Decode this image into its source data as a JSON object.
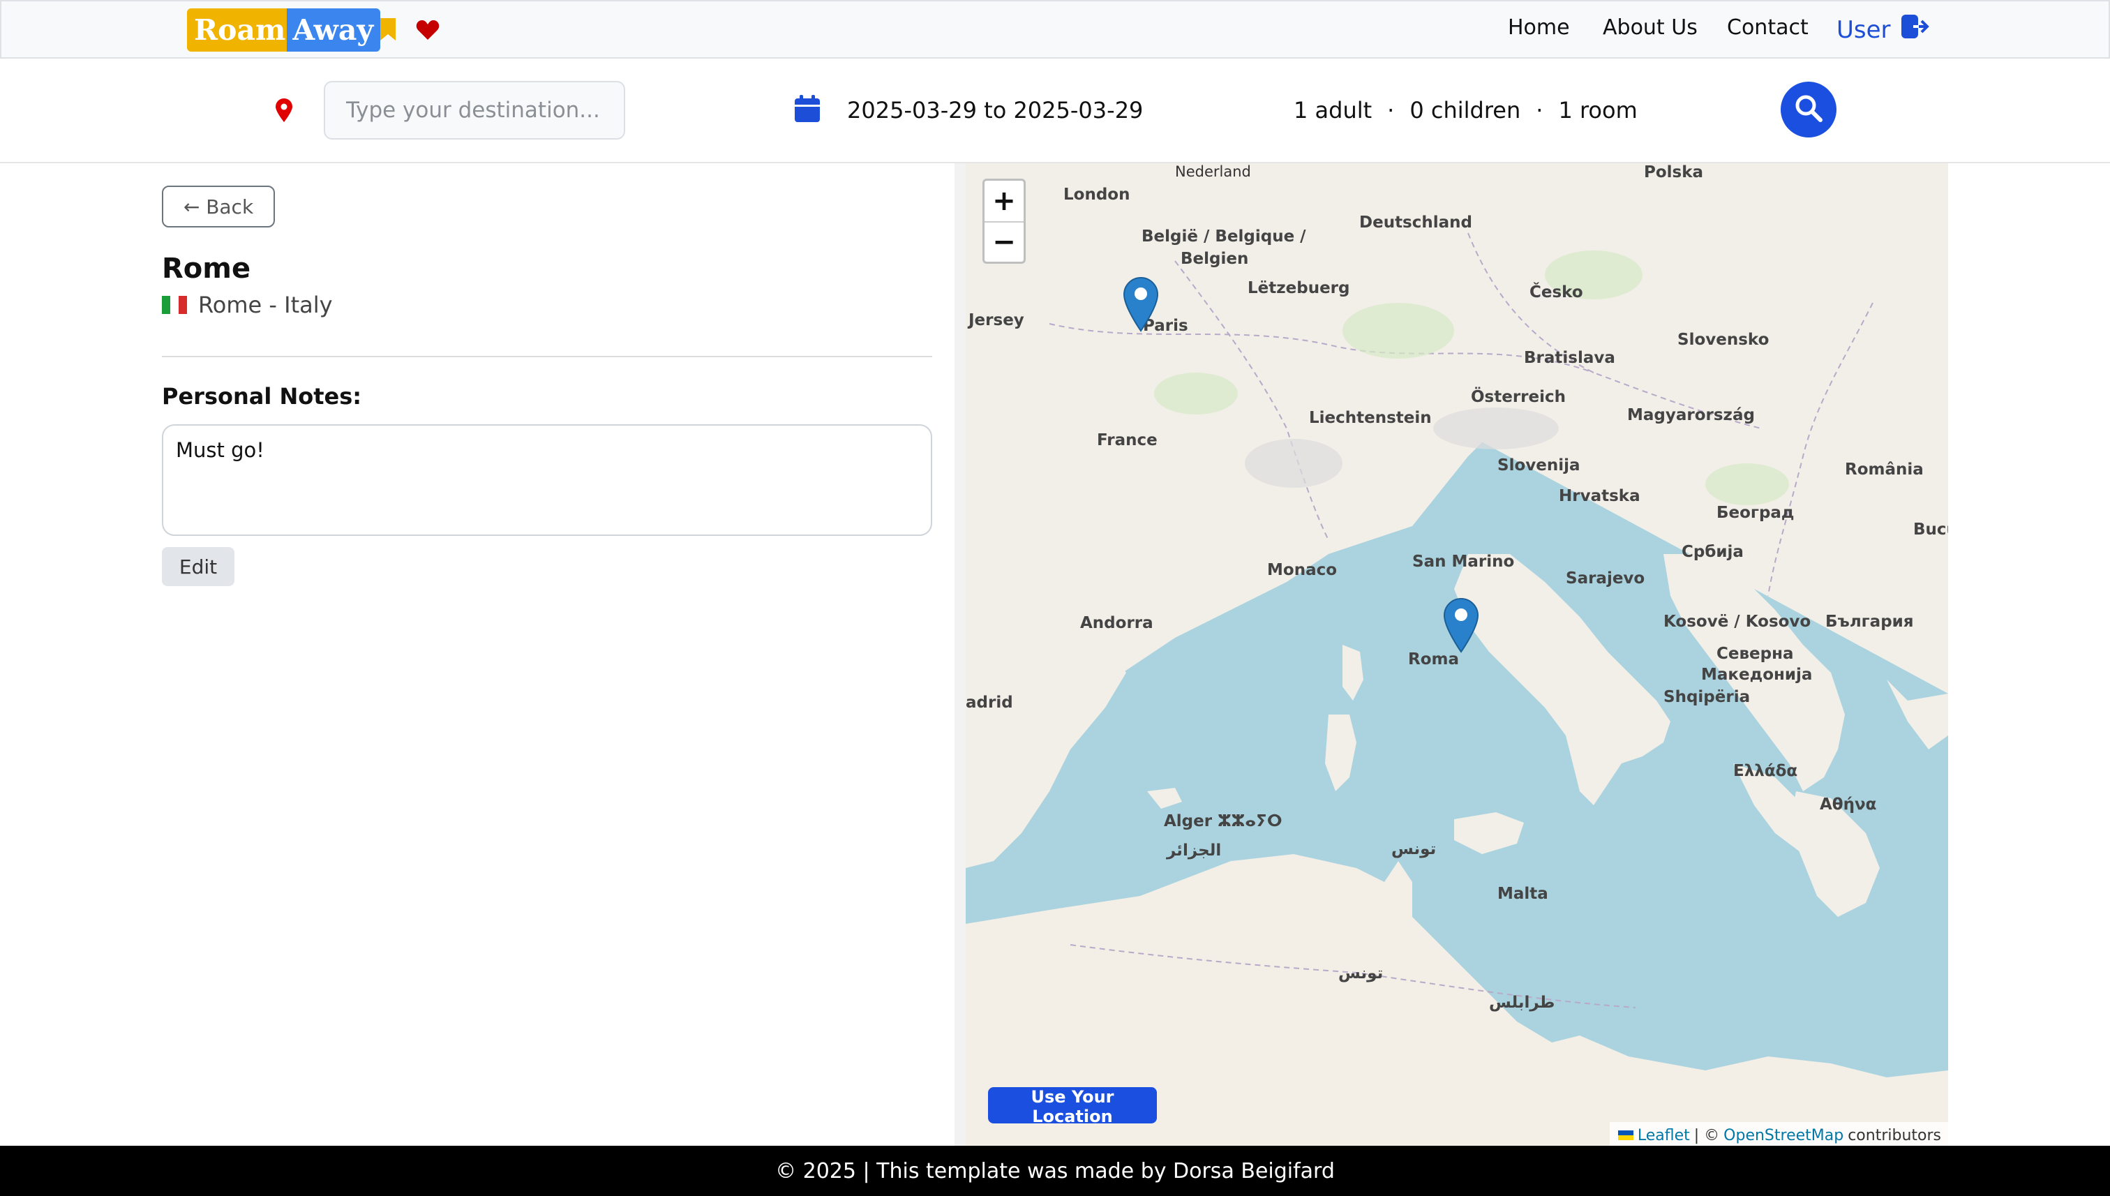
{
  "brand": {
    "part1": "Roam",
    "part2": "Away"
  },
  "nav": {
    "links": [
      "Home",
      "About Us",
      "Contact"
    ],
    "user_label": "User"
  },
  "search": {
    "destination_placeholder": "Type your destination...",
    "dates": "2025-03-29 to 2025-03-29",
    "adults": "1 adult",
    "children": "0 children",
    "rooms": "1 room",
    "separator": "·"
  },
  "detail": {
    "back_label": "← Back",
    "title": "Rome",
    "subtitle": "Rome - Italy",
    "notes_label": "Personal Notes:",
    "notes_value": "Must go!",
    "edit_label": "Edit"
  },
  "map": {
    "zoom_in": "+",
    "zoom_out": "−",
    "use_location_label": "Use Your Location",
    "attribution": {
      "leaflet": "Leaflet",
      "sep": "| ©",
      "osm": "OpenStreetMap",
      "tail": "contributors"
    },
    "labels": {
      "london": "London",
      "nederland": "Nederland",
      "deutschland": "Deutschland",
      "belgie": "België / Belgique /",
      "belgien": "Belgien",
      "letzebuerg": "Lëtzebuerg",
      "paris": "Paris",
      "jersey": "Jersey",
      "cesko": "Česko",
      "polska": "Polska",
      "slovensko": "Slovensko",
      "bratislava": "Bratislava",
      "osterreich": "Österreich",
      "magyarorszag": "Magyarország",
      "liechtenstein": "Liechtenstein",
      "france": "France",
      "slovenija": "Slovenija",
      "hrvatska": "Hrvatska",
      "romania": "România",
      "beograd": "Београд",
      "srbija": "Србија",
      "bucure": "Bucure",
      "san_marino": "San Marino",
      "monaco": "Monaco",
      "sarajevo": "Sarajevo",
      "andorra": "Andorra",
      "kosove": "Kosovë / Kosovo",
      "bulgaria": "България",
      "roma": "Roma",
      "severna": "Северна",
      "makedonija": "Македонија",
      "shqiperia": "Shqipëria",
      "madrid": "adrid",
      "ellada": "Ελλάδα",
      "athina": "Αθήνα",
      "alger": "Alger ⵣⵣⴰⵢⵔ",
      "aljazair": "الجزائر",
      "tunis_ar": "تونس",
      "malta": "Malta",
      "tunis2_ar": "تونس",
      "tripoli_ar": "طرابلس"
    }
  },
  "footer": {
    "text": "© 2025 | This template was made by Dorsa Beigifard"
  },
  "colors": {
    "accent": "#1a4fe0",
    "logo_yellow": "#f0b400",
    "logo_blue": "#3a86ee",
    "heart": "#c40000",
    "pin": "#e00000"
  },
  "icons": [
    "bookmark-icon",
    "heart-icon",
    "logout-icon",
    "location-pin-icon",
    "calendar-icon",
    "search-icon",
    "map-marker-icon"
  ]
}
